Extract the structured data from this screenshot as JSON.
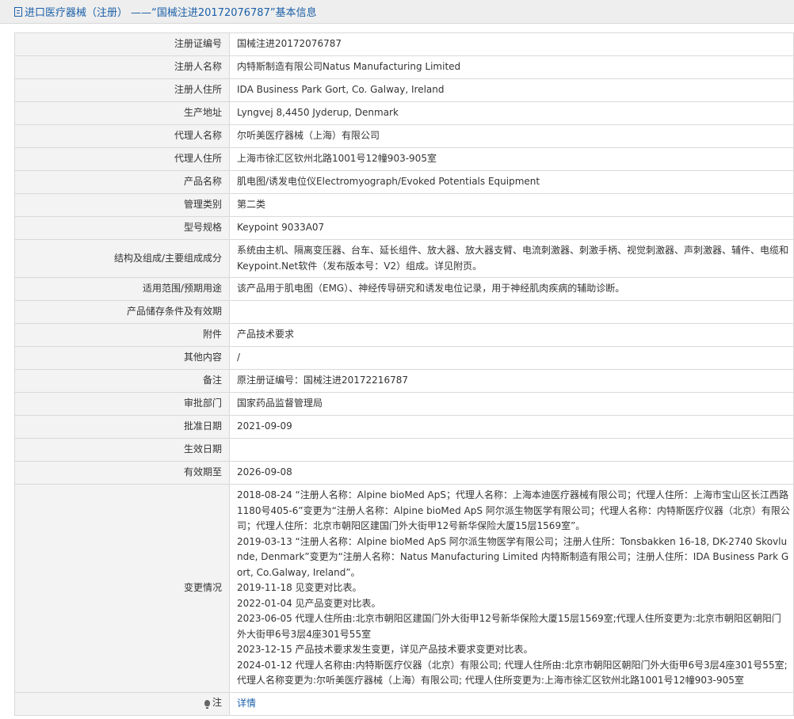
{
  "header": {
    "title": "进口医疗器械（注册） ——“国械注进20172076787”基本信息"
  },
  "rows": [
    {
      "label": "注册证编号",
      "value": "国械注进20172076787"
    },
    {
      "label": "注册人名称",
      "value": "内特斯制造有限公司Natus Manufacturing Limited"
    },
    {
      "label": "注册人住所",
      "value": "IDA Business Park Gort, Co. Galway, Ireland"
    },
    {
      "label": "生产地址",
      "value": "Lyngvej 8,4450 Jyderup, Denmark"
    },
    {
      "label": "代理人名称",
      "value": "尔听美医疗器械（上海）有限公司"
    },
    {
      "label": "代理人住所",
      "value": "上海市徐汇区钦州北路1001号12幢903-905室"
    },
    {
      "label": "产品名称",
      "value": "肌电图/诱发电位仪Electromyograph/Evoked Potentials Equipment"
    },
    {
      "label": "管理类别",
      "value": "第二类"
    },
    {
      "label": "型号规格",
      "value": "Keypoint 9033A07"
    },
    {
      "label": "结构及组成/主要组成成分",
      "value": "系统由主机、隔离变压器、台车、延长组件、放大器、放大器支臂、电流刺激器、刺激手柄、视觉刺激器、声刺激器、辅件、电缆和Keypoint.Net软件（发布版本号：V2）组成。详见附页。"
    },
    {
      "label": "适用范围/预期用途",
      "value": "该产品用于肌电图（EMG）、神经传导研究和诱发电位记录，用于神经肌肉疾病的辅助诊断。"
    },
    {
      "label": "产品储存条件及有效期",
      "value": ""
    },
    {
      "label": "附件",
      "value": "产品技术要求"
    },
    {
      "label": "其他内容",
      "value": "/"
    },
    {
      "label": "备注",
      "value": "原注册证编号：国械注进20172216787"
    },
    {
      "label": "审批部门",
      "value": "国家药品监督管理局"
    },
    {
      "label": "批准日期",
      "value": "2021-09-09"
    },
    {
      "label": "生效日期",
      "value": ""
    },
    {
      "label": "有效期至",
      "value": "2026-09-08"
    }
  ],
  "changes": {
    "label": "变更情况",
    "entries": [
      "2018-08-24 “注册人名称：Alpine bioMed ApS；代理人名称：上海本迪医疗器械有限公司；代理人住所：上海市宝山区长江西路1180号405-6”变更为“注册人名称：Alpine bioMed ApS 阿尔派生物医学有限公司；代理人名称：内特斯医疗仪器（北京）有限公司；代理人住所：北京市朝阳区建国门外大街甲12号新华保险大厦15层1569室”。",
      "2019-03-13 “注册人名称：Alpine bioMed ApS 阿尔派生物医学有限公司；注册人住所：Tonsbakken 16-18, DK-2740 Skovlunde, Denmark”变更为“注册人名称：Natus Manufacturing Limited 内特斯制造有限公司；注册人住所：IDA Business Park Gort, Co.Galway, Ireland”。",
      "2019-11-18 见变更对比表。",
      "2022-01-04 见产品变更对比表。",
      "2023-06-05 代理人住所由:北京市朝阳区建国门外大街甲12号新华保险大厦15层1569室;代理人住所变更为:北京市朝阳区朝阳门外大街甲6号3层4座301号55室",
      "2023-12-15 产品技术要求发生变更，详见产品技术要求变更对比表。",
      "2024-01-12 代理人名称由:内特斯医疗仪器（北京）有限公司; 代理人住所由:北京市朝阳区朝阳门外大街甲6号3层4座301号55室;代理人名称变更为:尔听美医疗器械（上海）有限公司; 代理人住所变更为:上海市徐汇区钦州北路1001号12幢903-905室"
    ]
  },
  "note": {
    "label": "注",
    "link_text": "详情"
  },
  "icons": {
    "header_icon": "document-icon",
    "note_icon": "lightbulb-icon"
  },
  "colors": {
    "link": "#1a5fa8",
    "label_bg": "#f3f3f3",
    "header_bg": "#eeeeee"
  }
}
